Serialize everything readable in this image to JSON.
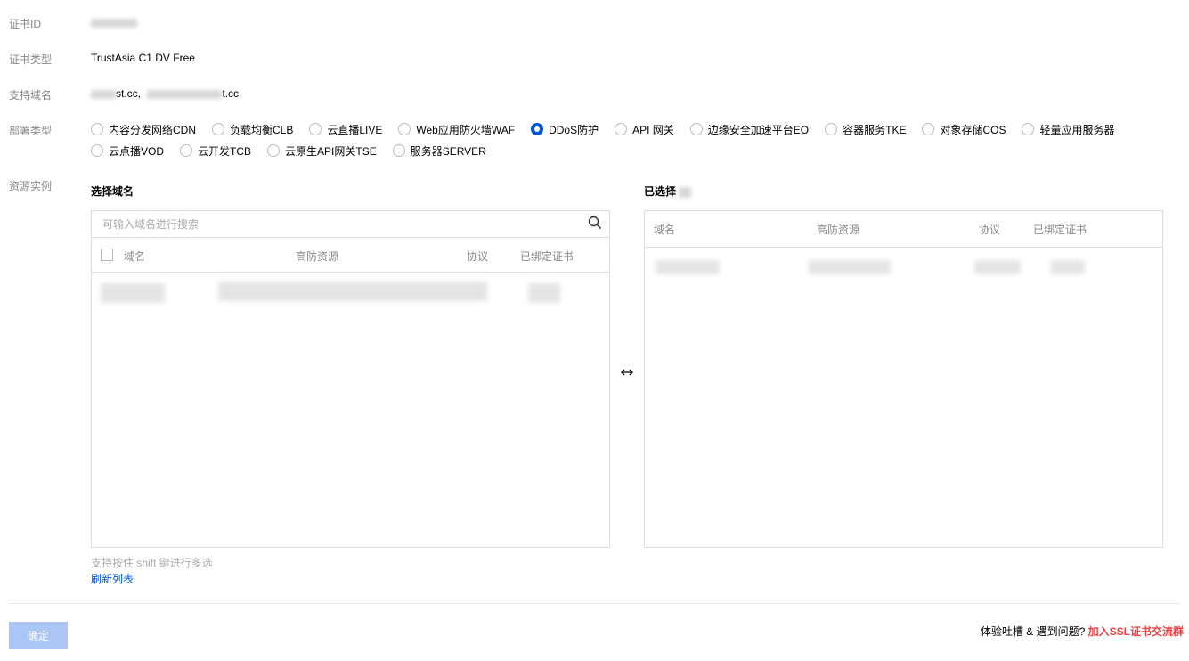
{
  "fields": {
    "cert_id_label": "证书ID",
    "cert_type_label": "证书类型",
    "cert_type_value": "TrustAsia C1 DV Free",
    "domain_label": "支持域名",
    "domain_value_1_suffix": "st.cc,",
    "domain_value_2_suffix": "t.cc",
    "deploy_label": "部署类型",
    "resource_label": "资源实例"
  },
  "deploy_types_row1": [
    {
      "label": "内容分发网络CDN",
      "checked": false
    },
    {
      "label": "负载均衡CLB",
      "checked": false
    },
    {
      "label": "云直播LIVE",
      "checked": false
    },
    {
      "label": "Web应用防火墙WAF",
      "checked": false
    },
    {
      "label": "DDoS防护",
      "checked": true
    },
    {
      "label": "API 网关",
      "checked": false
    },
    {
      "label": "边缘安全加速平台EO",
      "checked": false
    },
    {
      "label": "容器服务TKE",
      "checked": false
    },
    {
      "label": "对象存储COS",
      "checked": false
    },
    {
      "label": "轻量应用服务器",
      "checked": false
    }
  ],
  "deploy_types_row2": [
    {
      "label": "云点播VOD",
      "checked": false
    },
    {
      "label": "云开发TCB",
      "checked": false
    },
    {
      "label": "云原生API网关TSE",
      "checked": false
    },
    {
      "label": "服务器SERVER",
      "checked": false
    }
  ],
  "left_panel": {
    "title": "选择域名",
    "search_placeholder": "可输入域名进行搜索",
    "columns": [
      "域名",
      "高防资源",
      "协议",
      "已绑定证书"
    ]
  },
  "right_panel": {
    "title": "已选择",
    "columns": [
      "域名",
      "高防资源",
      "协议",
      "已绑定证书"
    ]
  },
  "hint": "支持按住 shift 键进行多选",
  "refresh_link": "刷新列表",
  "confirm_button": "确定",
  "feedback_text": "体验吐槽 & 遇到问题?",
  "feedback_link": "加入SSL证书交流群",
  "colors": {
    "accent": "#0052d9",
    "link_red": "#e54545"
  }
}
